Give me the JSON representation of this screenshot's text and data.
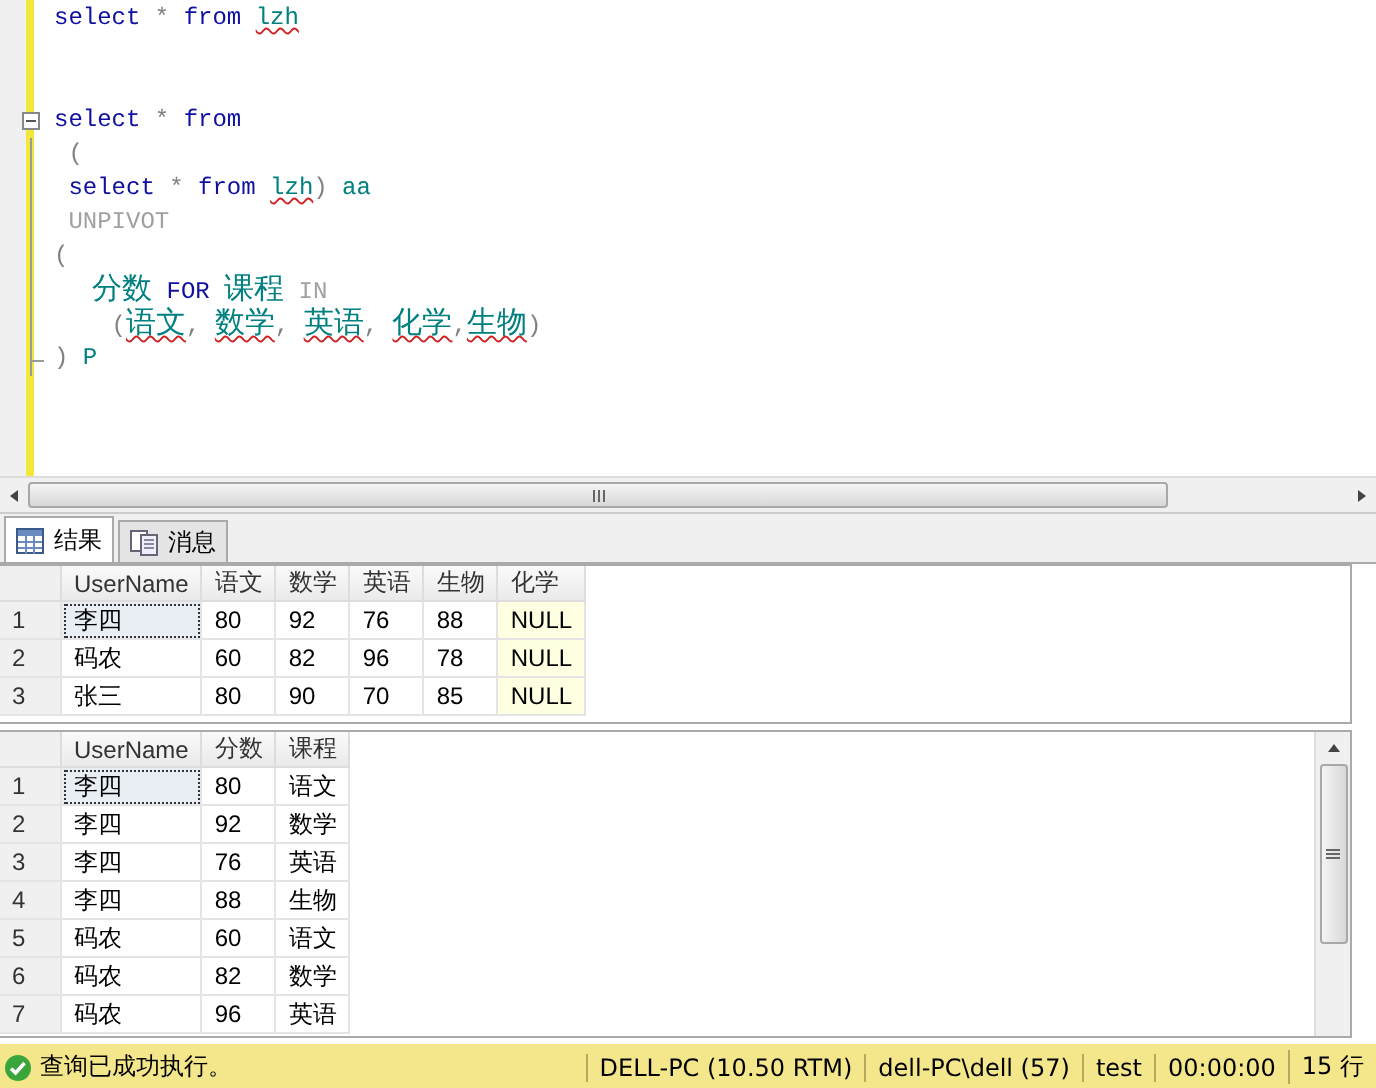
{
  "editor": {
    "lines": [
      {
        "fold": false,
        "segments": [
          {
            "kind": "keyword",
            "text": "select"
          },
          {
            "kind": "operator",
            "text": " * "
          },
          {
            "kind": "keyword",
            "text": "from "
          },
          {
            "kind": "misspelled",
            "text": "lzh"
          }
        ]
      },
      {
        "fold": false
      },
      {
        "fold": false
      },
      {
        "fold": true,
        "segments": [
          {
            "kind": "keyword",
            "text": "select"
          },
          {
            "kind": "operator",
            "text": " * "
          },
          {
            "kind": "keyword",
            "text": "from"
          }
        ]
      },
      {
        "fold": false,
        "segments": [
          {
            "kind": "operator",
            "text": " ("
          }
        ]
      },
      {
        "fold": false,
        "segments": [
          {
            "kind": "keyword",
            "text": " select"
          },
          {
            "kind": "operator",
            "text": " * "
          },
          {
            "kind": "keyword",
            "text": "from "
          },
          {
            "kind": "misspelled",
            "text": "lzh"
          },
          {
            "kind": "operator",
            "text": ")"
          },
          {
            "kind": "identifier",
            "text": " aa"
          }
        ]
      },
      {
        "fold": false,
        "segments": [
          {
            "kind": "system",
            "text": " UNPIVOT"
          }
        ]
      },
      {
        "fold": false,
        "segments": [
          {
            "kind": "operator",
            "text": "("
          }
        ]
      },
      {
        "fold": false,
        "segments": [
          {
            "kind": "identifier",
            "text": "    分数"
          },
          {
            "kind": "keyword",
            "text": " FOR "
          },
          {
            "kind": "identifier",
            "text": "课程"
          },
          {
            "kind": "system",
            "text": " IN"
          }
        ]
      },
      {
        "fold": false,
        "segments": [
          {
            "kind": "operator",
            "text": "    ("
          },
          {
            "kind": "misspelled",
            "text": "语文"
          },
          {
            "kind": "operator",
            "text": ", "
          },
          {
            "kind": "misspelled",
            "text": "数学"
          },
          {
            "kind": "operator",
            "text": ", "
          },
          {
            "kind": "misspelled",
            "text": "英语"
          },
          {
            "kind": "operator",
            "text": ", "
          },
          {
            "kind": "misspelled",
            "text": "化学"
          },
          {
            "kind": "operator",
            "text": ","
          },
          {
            "kind": "misspelled",
            "text": "生物"
          },
          {
            "kind": "operator",
            "text": ")"
          }
        ]
      },
      {
        "fold": false,
        "segments": [
          {
            "kind": "operator",
            "text": ") "
          },
          {
            "kind": "identifier",
            "text": "P"
          }
        ]
      }
    ]
  },
  "tabs": [
    {
      "label": "结果",
      "kind": "grid",
      "selected": true
    },
    {
      "label": "消息",
      "kind": "messages",
      "selected": false
    }
  ],
  "grids": [
    {
      "columns": [
        "UserName",
        "语文",
        "数学",
        "英语",
        "生物",
        "化学"
      ],
      "rows": [
        {
          "number": "1",
          "cells": [
            "李四",
            "80",
            "92",
            "76",
            "88",
            "NULL"
          ]
        },
        {
          "number": "2",
          "cells": [
            "码农",
            "60",
            "82",
            "96",
            "78",
            "NULL"
          ]
        },
        {
          "number": "3",
          "cells": [
            "张三",
            "80",
            "90",
            "70",
            "85",
            "NULL"
          ]
        }
      ]
    },
    {
      "columns": [
        "UserName",
        "分数",
        "课程"
      ],
      "rows": [
        {
          "number": "1",
          "cells": [
            "李四",
            "80",
            "语文"
          ]
        },
        {
          "number": "2",
          "cells": [
            "李四",
            "92",
            "数学"
          ]
        },
        {
          "number": "3",
          "cells": [
            "李四",
            "76",
            "英语"
          ]
        },
        {
          "number": "4",
          "cells": [
            "李四",
            "88",
            "生物"
          ]
        },
        {
          "number": "5",
          "cells": [
            "码农",
            "60",
            "语文"
          ]
        },
        {
          "number": "6",
          "cells": [
            "码农",
            "82",
            "数学"
          ]
        },
        {
          "number": "7",
          "cells": [
            "码农",
            "96",
            "英语"
          ]
        }
      ]
    }
  ],
  "status_bar": {
    "message": "查询已成功执行。",
    "server": "DELL-PC (10.50 RTM)",
    "user": "dell-PC\\dell (57)",
    "database": "test",
    "elapsed": "00:00:00",
    "rows": "15 行"
  }
}
